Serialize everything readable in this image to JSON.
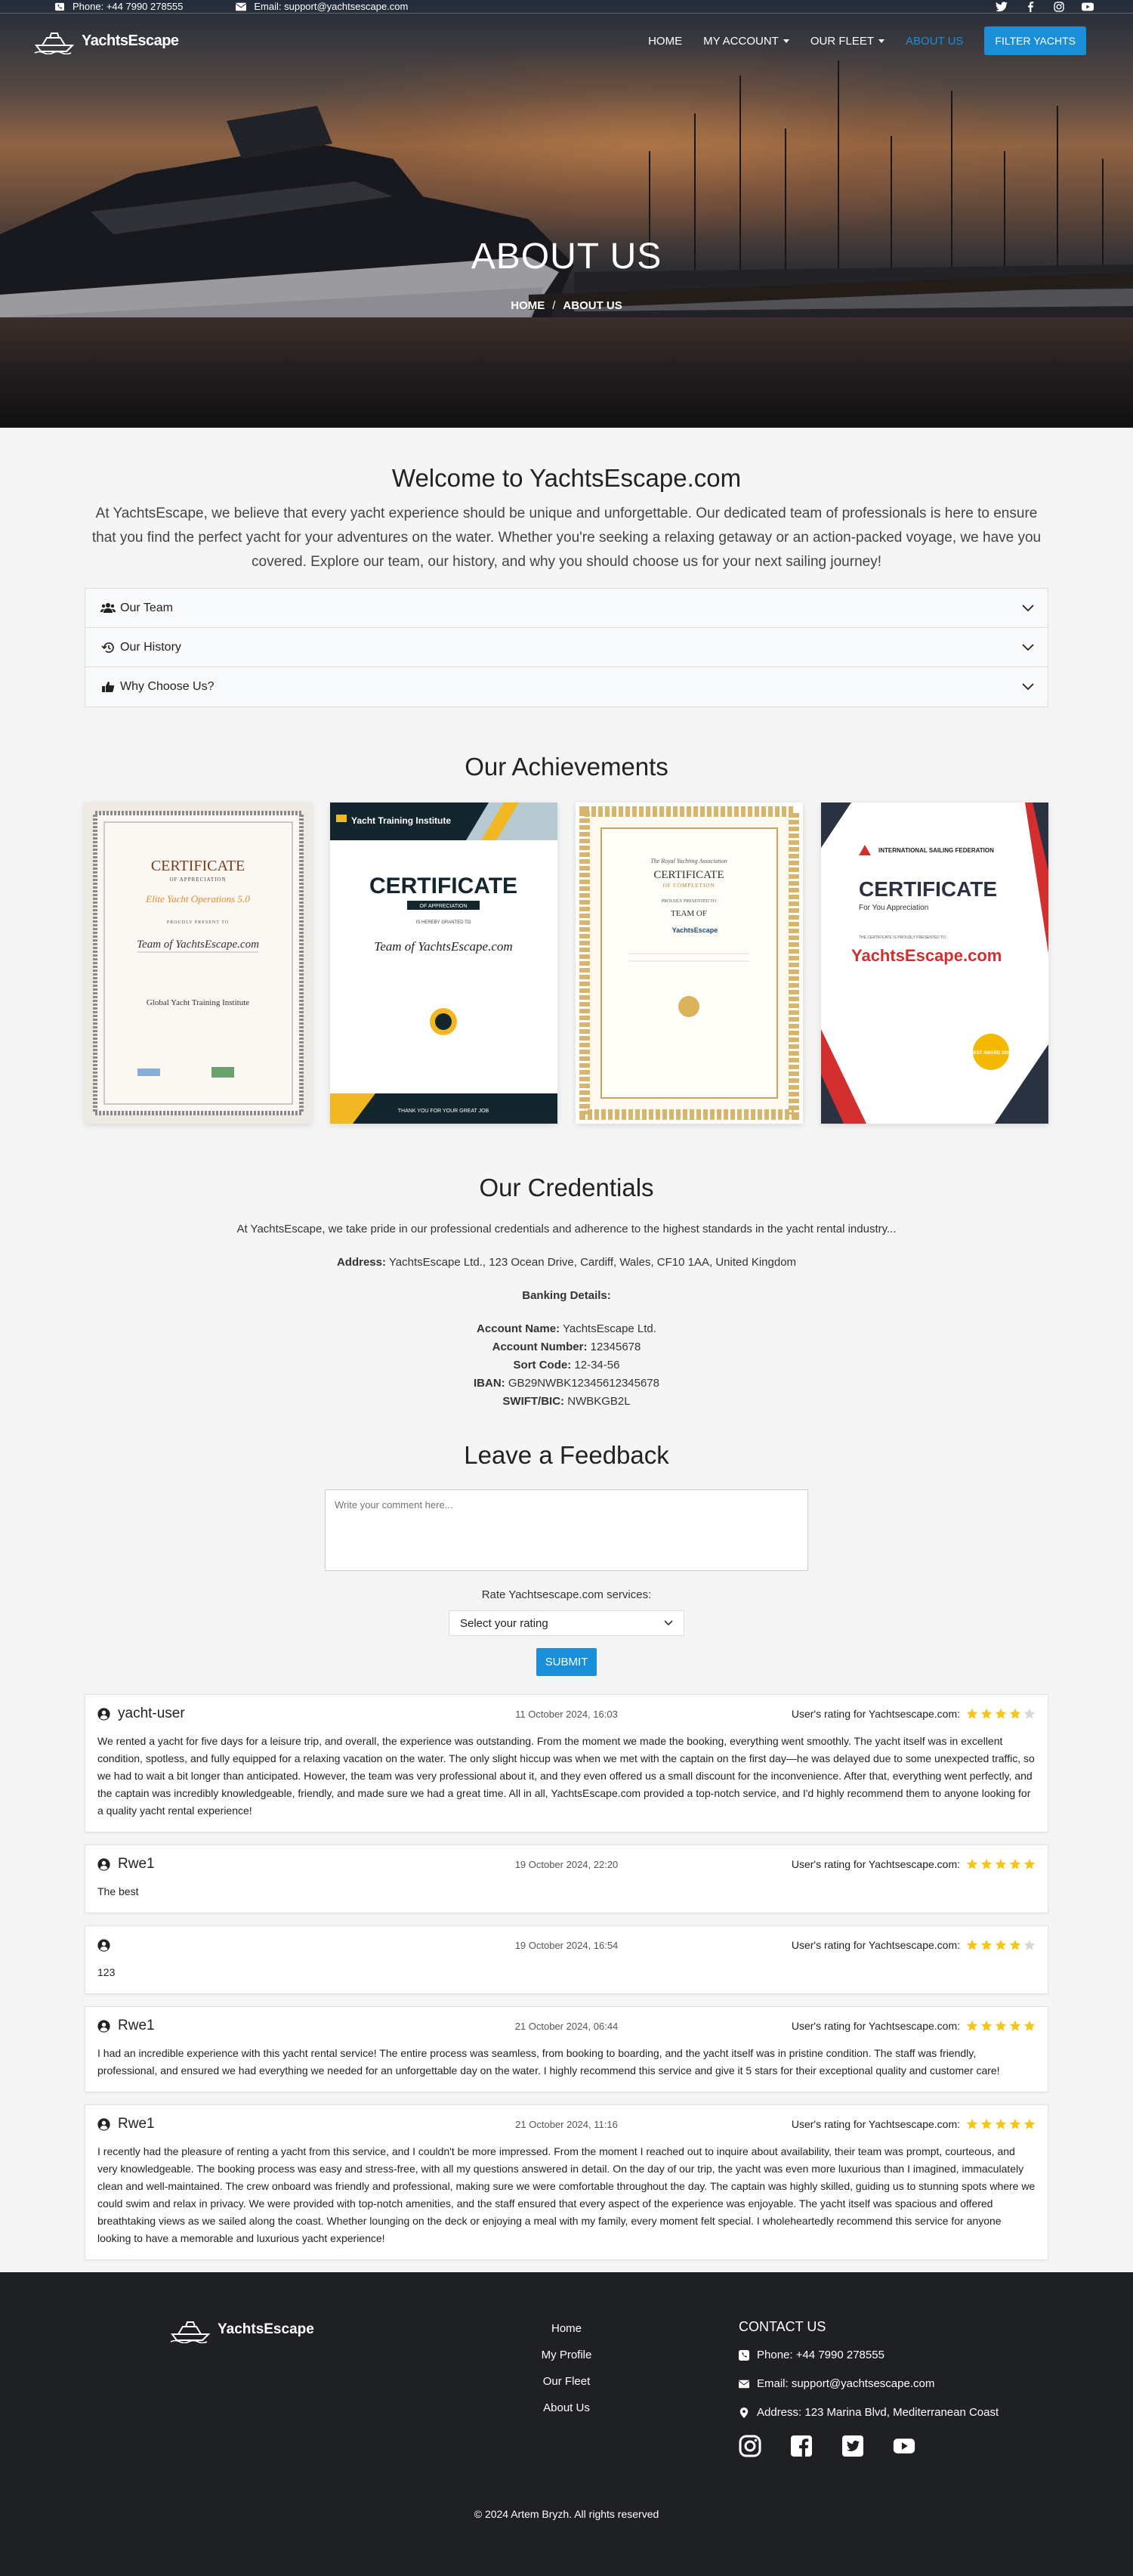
{
  "topbar": {
    "phone": "Phone: +44 7990 278555",
    "email": "Email: support@yachtsescape.com"
  },
  "brand": {
    "name": "YachtsEscape"
  },
  "nav": {
    "home": "HOME",
    "account": "MY ACCOUNT",
    "fleet": "OUR FLEET",
    "about": "ABOUT US",
    "filter": "FILTER YACHTS"
  },
  "hero": {
    "title": "ABOUT US",
    "crumb_home": "HOME",
    "crumb_sep": "/",
    "crumb_current": "ABOUT US"
  },
  "welcome": {
    "title": "Welcome to YachtsEscape.com",
    "text": "At YachtsEscape, we believe that every yacht experience should be unique and unforgettable. Our dedicated team of professionals is here to ensure that you find the perfect yacht for your adventures on the water. Whether you're seeking a relaxing getaway or an action-packed voyage, we have you covered. Explore our team, our history, and why you should choose us for your next sailing journey!"
  },
  "accordion": [
    {
      "label": "Our Team",
      "icon": "users-icon"
    },
    {
      "label": "Our History",
      "icon": "history-icon"
    },
    {
      "label": "Why Choose Us?",
      "icon": "thumbs-up-icon"
    }
  ],
  "achievements": {
    "title": "Our Achievements",
    "certs": [
      {
        "heading": "CERTIFICATE",
        "sub": "OF APPRECIATION",
        "org": "Elite Yacht Operations 5.0",
        "presented": "PROUDLY PRESENT TO",
        "team": "Team of YachtsEscape.com",
        "issuer": "Global Yacht Training Institute"
      },
      {
        "org": "Yacht Training Institute",
        "heading": "CERTIFICATE",
        "sub": "OF APPRECIATION",
        "presented": "IS HEREBY GRANTED TO",
        "team": "Team of YachtsEscape.com",
        "footer": "THANK YOU FOR YOUR GREAT JOB"
      },
      {
        "org": "The Royal Yachting Association",
        "heading": "CERTIFICATE",
        "sub": "OF COMPLETION",
        "presented": "PROUDLY PRESENTED TO",
        "team": "TEAM OF",
        "brand": "YachtsEscape"
      },
      {
        "org": "INTERNATIONAL SAILING FEDERATION",
        "heading": "CERTIFICATE",
        "sub": "For You Appreciation",
        "presented": "THE CERTIFICATE IS PROUDLY PRESENTED TO",
        "team": "YachtsEscape.com",
        "badge": "BEST AWARD 2024"
      }
    ]
  },
  "credentials": {
    "title": "Our Credentials",
    "intro": "At YachtsEscape, we take pride in our professional credentials and adherence to the highest standards in the yacht rental industry...",
    "address_label": "Address:",
    "address": "YachtsEscape Ltd., 123 Ocean Drive, Cardiff, Wales, CF10 1AA, United Kingdom",
    "banking_label": "Banking Details:",
    "account_name_label": "Account Name:",
    "account_name": "YachtsEscape Ltd.",
    "account_number_label": "Account Number:",
    "account_number": "12345678",
    "sort_code_label": "Sort Code:",
    "sort_code": "12-34-56",
    "iban_label": "IBAN:",
    "iban": "GB29NWBK12345612345678",
    "swift_label": "SWIFT/BIC:",
    "swift": "NWBKGB2L"
  },
  "feedback": {
    "title": "Leave a Feedback",
    "placeholder": "Write your comment here...",
    "rate_label": "Rate Yachtsescape.com services:",
    "rate_selected": "Select your rating",
    "submit": "SUBMIT"
  },
  "reviews": [
    {
      "user": "yacht-user",
      "date": "11 October 2024, 16:03",
      "rating_label": "User's rating for Yachtsescape.com:",
      "rating": 4,
      "text": "We rented a yacht for five days for a leisure trip, and overall, the experience was outstanding. From the moment we made the booking, everything went smoothly. The yacht itself was in excellent condition, spotless, and fully equipped for a relaxing vacation on the water. The only slight hiccup was when we met with the captain on the first day—he was delayed due to some unexpected traffic, so we had to wait a bit longer than anticipated. However, the team was very professional about it, and they even offered us a small discount for the inconvenience. After that, everything went perfectly, and the captain was incredibly knowledgeable, friendly, and made sure we had a great time. All in all, YachtsEscape.com provided a top-notch service, and I'd highly recommend them to anyone looking for a quality yacht rental experience!"
    },
    {
      "user": "Rwe1",
      "date": "19 October 2024, 22:20",
      "rating_label": "User's rating for Yachtsescape.com:",
      "rating": 5,
      "text": "The best"
    },
    {
      "user": "",
      "date": "19 October 2024, 16:54",
      "rating_label": "User's rating for Yachtsescape.com:",
      "rating": 4,
      "text": "123"
    },
    {
      "user": "Rwe1",
      "date": "21 October 2024, 06:44",
      "rating_label": "User's rating for Yachtsescape.com:",
      "rating": 5,
      "text": "I had an incredible experience with this yacht rental service! The entire process was seamless, from booking to boarding, and the yacht itself was in pristine condition. The staff was friendly, professional, and ensured we had everything we needed for an unforgettable day on the water. I highly recommend this service and give it 5 stars for their exceptional quality and customer care!"
    },
    {
      "user": "Rwe1",
      "date": "21 October 2024, 11:16",
      "rating_label": "User's rating for Yachtsescape.com:",
      "rating": 5,
      "text": "I recently had the pleasure of renting a yacht from this service, and I couldn't be more impressed. From the moment I reached out to inquire about availability, their team was prompt, courteous, and very knowledgeable. The booking process was easy and stress-free, with all my questions answered in detail. On the day of our trip, the yacht was even more luxurious than I imagined, immaculately clean and well-maintained. The crew onboard was friendly and professional, making sure we were comfortable throughout the day. The captain was highly skilled, guiding us to stunning spots where we could swim and relax in privacy. We were provided with top-notch amenities, and the staff ensured that every aspect of the experience was enjoyable. The yacht itself was spacious and offered breathtaking views as we sailed along the coast. Whether lounging on the deck or enjoying a meal with my family, every moment felt special. I wholeheartedly recommend this service for anyone looking to have a memorable and luxurious yacht experience!"
    }
  ],
  "footer": {
    "brand": "YachtsEscape",
    "links": [
      "Home",
      "My Profile",
      "Our Fleet",
      "About Us"
    ],
    "contact_title": "CONTACT US",
    "phone": "Phone: +44 7990 278555",
    "email": "Email: support@yachtsescape.com",
    "address": "Address: 123 Marina Blvd, Mediterranean Coast",
    "copyright": "© 2024    Artem Bryzh.    All rights reserved"
  },
  "colors": {
    "accent": "#1a8fd8",
    "star": "#f5c518",
    "footer_bg": "#1e2024"
  }
}
